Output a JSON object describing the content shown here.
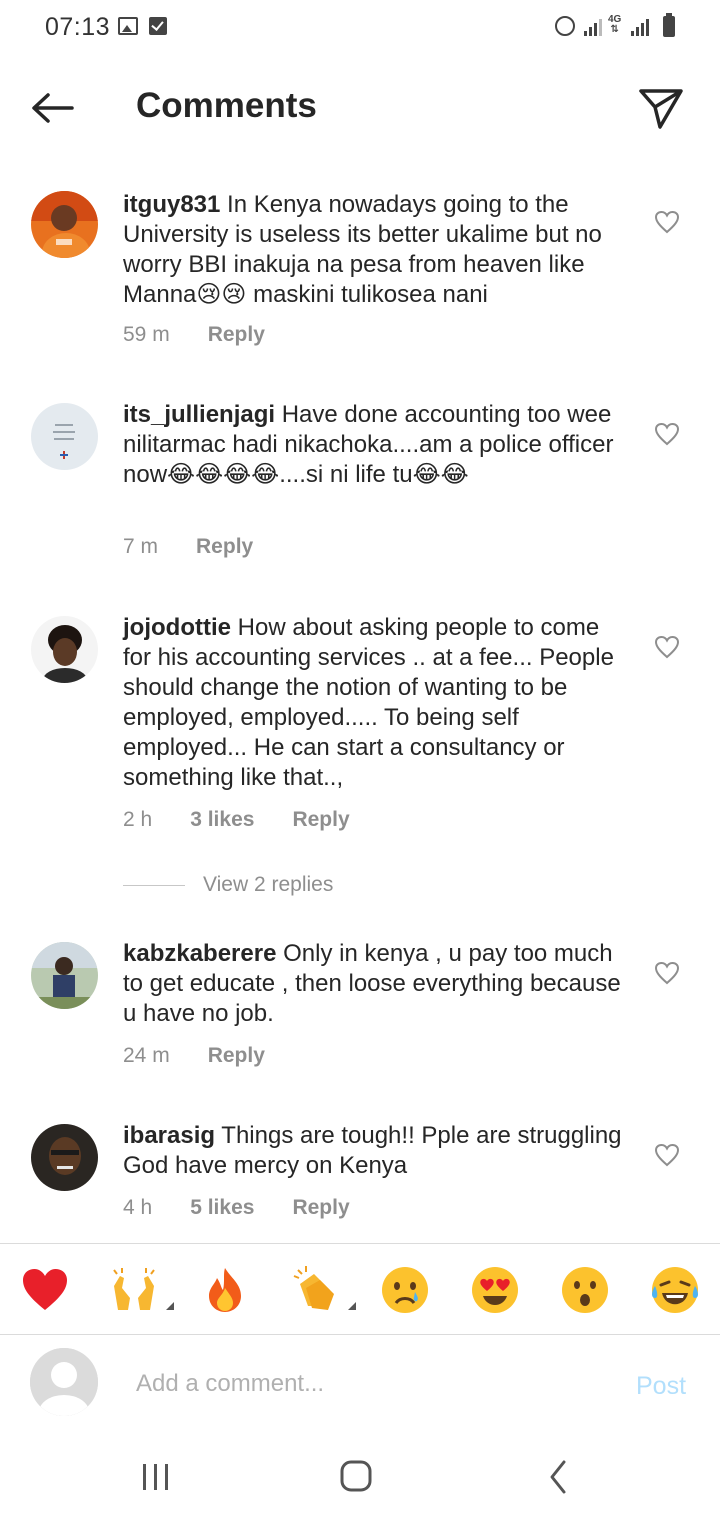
{
  "status_bar": {
    "time": "07:13",
    "network_label_top": "4G",
    "network_label_bottom": "⇅"
  },
  "header": {
    "title": "Comments",
    "back_icon": "arrow-left-icon",
    "share_icon": "paper-plane-icon"
  },
  "comments": [
    {
      "username": "itguy831",
      "text": "In Kenya nowadays going to the University is useless its better ukalime but no worry BBI  inakuja na pesa from heaven like Manna😢😢 maskini tulikosea nani",
      "time": "59 m",
      "likes": "",
      "reply_label": "Reply"
    },
    {
      "username": "its_jullienjagi",
      "text": "Have done accounting too wee nilitarmac hadi nikachoka....am a police officer now😂😂😂😂....si ni life tu😂😂",
      "time": "7 m",
      "likes": "",
      "reply_label": "Reply"
    },
    {
      "username": "jojodottie",
      "text": "How about asking people to come for his accounting services .. at a fee... People should change the notion of wanting to be employed, employed..... To being self employed... He can start a consultancy or something like that..,",
      "time": "2 h",
      "likes": "3 likes",
      "reply_label": "Reply",
      "view_replies": "View 2 replies"
    },
    {
      "username": "kabzkaberere",
      "text": "Only in kenya , u pay too much to get educate , then loose everything because u have no job.",
      "time": "24 m",
      "likes": "",
      "reply_label": "Reply"
    },
    {
      "username": "ibarasig",
      "text": "Things are tough!! Pple are struggling  God have mercy on Kenya",
      "time": "4 h",
      "likes": "5 likes",
      "reply_label": "Reply"
    }
  ],
  "emoji_bar": [
    "❤️",
    "🙌",
    "🔥",
    "👏",
    "😢",
    "😍",
    "😮",
    "😂"
  ],
  "composer": {
    "placeholder": "Add a comment...",
    "post_label": "Post"
  },
  "nav_bar": {
    "recents_icon": "recents-icon",
    "home_icon": "home-icon",
    "back_icon": "back-icon"
  },
  "colors": {
    "text": "#262626",
    "secondary": "#8e8e8e",
    "post_disabled": "#b2dffc",
    "divider": "#dbdbdb"
  }
}
